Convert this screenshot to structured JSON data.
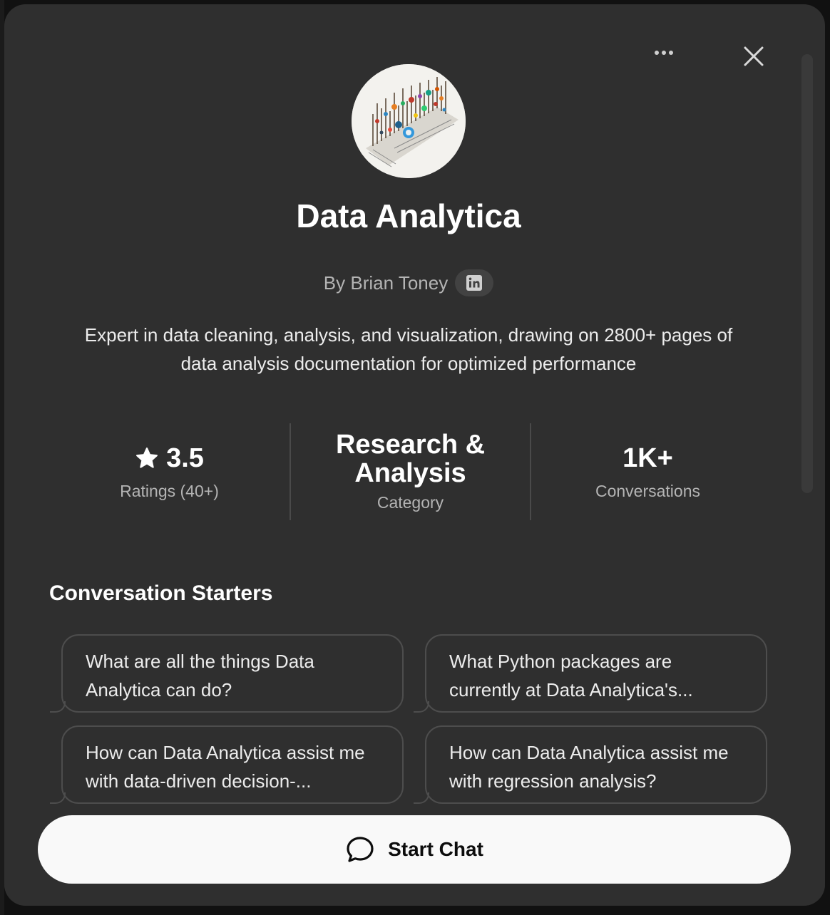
{
  "gpt": {
    "name": "Data Analytica",
    "author": "By Brian Toney",
    "description": "Expert in data cleaning, analysis, and visualization, drawing on 2800+ pages of data analysis documentation for optimized performance"
  },
  "stats": {
    "rating": {
      "value": "3.5",
      "label": "Ratings (40+)"
    },
    "category": {
      "value": "Research & Analysis",
      "label": "Category"
    },
    "conversations": {
      "value": "1K+",
      "label": "Conversations"
    }
  },
  "starters": {
    "heading": "Conversation Starters",
    "items": [
      "What are all the things Data Analytica can do?",
      "What Python packages are currently at Data Analytica's...",
      "How can Data Analytica assist me with data-driven decision-...",
      "How can Data Analytica assist me with regression analysis?"
    ]
  },
  "actions": {
    "start_chat_label": "Start Chat"
  },
  "icons": {
    "more": "more-horizontal-icon",
    "close": "close-icon",
    "linkedin": "linkedin-icon",
    "star": "star-icon",
    "chat": "chat-bubble-icon"
  },
  "colors": {
    "modal_bg": "#2f2f2f",
    "button_bg": "#f9f9f9",
    "muted_text": "#b4b4b4"
  }
}
